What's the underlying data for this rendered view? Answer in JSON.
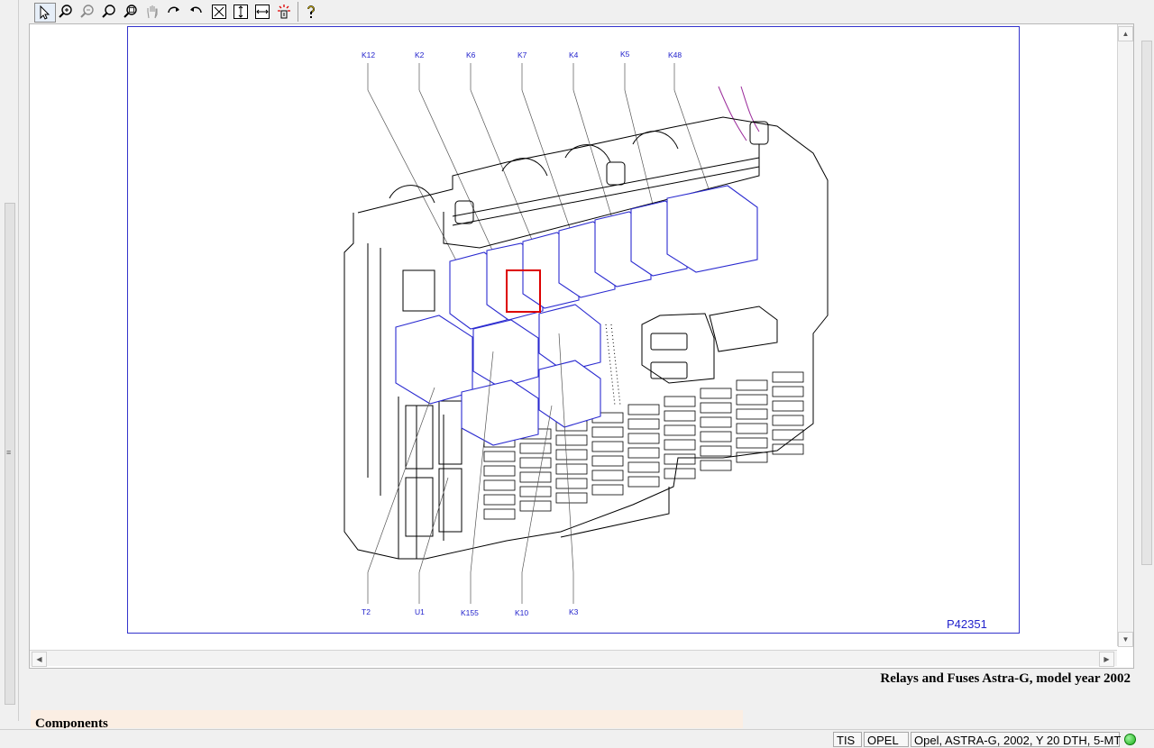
{
  "toolbar": {
    "buttons": [
      "select-arrow-icon",
      "zoom-in-icon",
      "zoom-out-icon",
      "zoom-icon",
      "zoom-window-icon",
      "pan-hand-icon",
      "rotate-right-icon",
      "rotate-left-icon",
      "fit-all-icon",
      "fit-height-icon",
      "fit-width-icon",
      "highlight-icon",
      "help-icon"
    ]
  },
  "drawing": {
    "id": "P42351",
    "top_labels": [
      "K12",
      "K2",
      "K6",
      "K7",
      "K4",
      "K5",
      "K48"
    ],
    "bottom_labels": [
      "T2",
      "U1",
      "K155",
      "K10",
      "K3"
    ]
  },
  "document": {
    "title": "Relays and Fuses Astra-G, model year 2002",
    "section_header": "Components"
  },
  "status": {
    "cells": [
      "TIS",
      "OPEL",
      "Opel, ASTRA-G, 2002, Y 20 DTH, 5-MT"
    ]
  },
  "colors": {
    "label_blue": "#2222cc",
    "highlight_red": "#dd0000",
    "status_ok": "#18b018"
  }
}
